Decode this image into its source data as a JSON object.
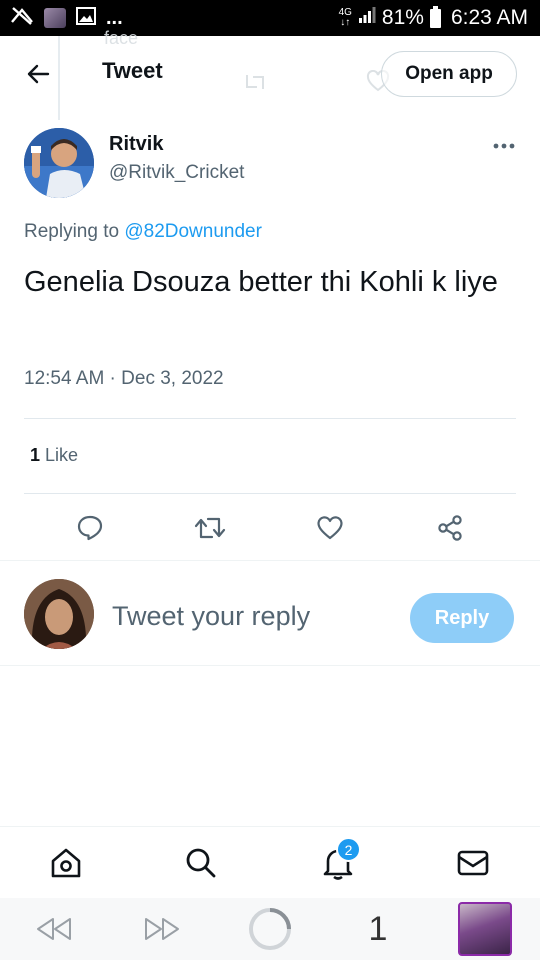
{
  "status_bar": {
    "notification_icons": [
      "signal-slash-icon",
      "photo-thumbnail-icon",
      "gallery-icon"
    ],
    "overflow": "...",
    "network_top": "4G",
    "battery_percent": "81%",
    "time": "6:23 AM"
  },
  "header": {
    "title": "Tweet",
    "open_app_label": "Open app",
    "ghost_text": "face"
  },
  "tweet": {
    "author_name": "Ritvik",
    "author_handle": "@Ritvik_Cricket",
    "replying_prefix": "Replying to ",
    "replying_to": "@82Downunder",
    "text": "Genelia Dsouza better thi Kohli k liye",
    "timestamp": "12:54 AM · Dec 3, 2022",
    "like_count": "1",
    "like_label": " Like"
  },
  "reply_box": {
    "placeholder": "Tweet your reply",
    "button_label": "Reply"
  },
  "tabbar": {
    "notification_badge": "2"
  },
  "system_nav": {
    "page_number": "1"
  },
  "colors": {
    "accent": "#1d9bf0",
    "reply_button_disabled": "#8ecdf8",
    "secondary_text": "#536471"
  }
}
